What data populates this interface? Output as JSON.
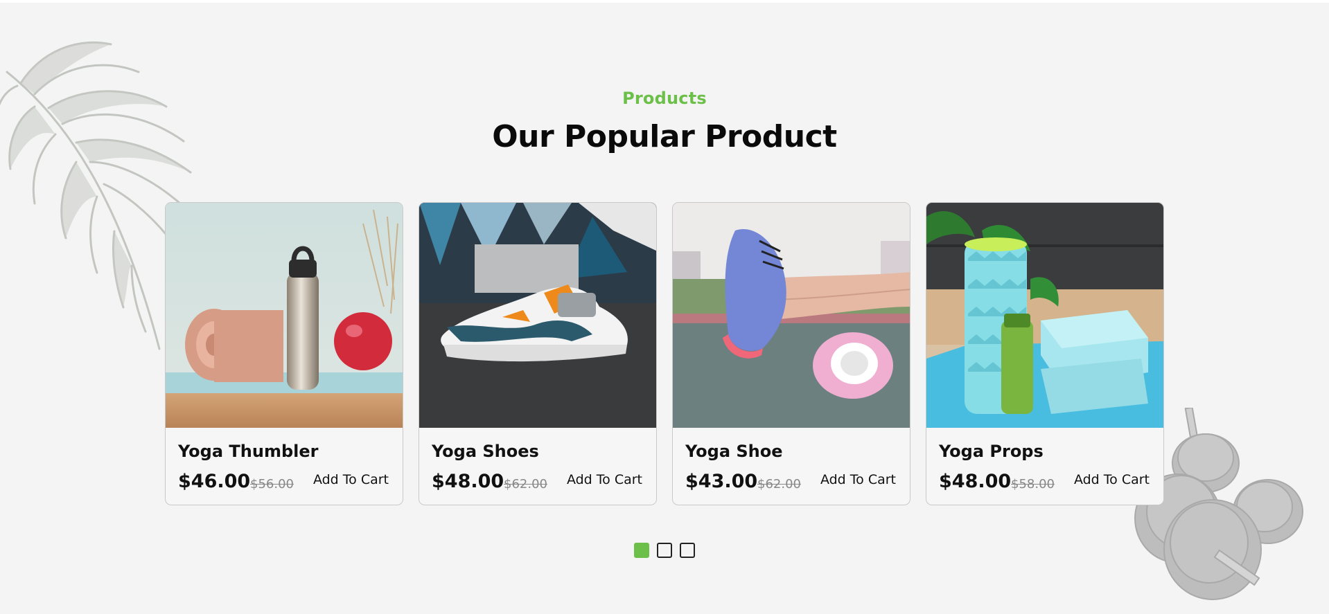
{
  "section": {
    "eyebrow": "Products",
    "title": "Our Popular Product"
  },
  "products": [
    {
      "name": "Yoga Thumbler",
      "price": "$46.00",
      "old_price": "$56.00",
      "cta": "Add To Cart",
      "image": "water-bottle-yoga-mat-ball"
    },
    {
      "name": "Yoga Shoes",
      "price": "$48.00",
      "old_price": "$62.00",
      "cta": "Add To Cart",
      "image": "sneaker-on-asphalt"
    },
    {
      "name": "Yoga Shoe",
      "price": "$43.00",
      "old_price": "$62.00",
      "cta": "Add To Cart",
      "image": "legs-on-foam-roller"
    },
    {
      "name": "Yoga Props",
      "price": "$48.00",
      "old_price": "$58.00",
      "cta": "Add To Cart",
      "image": "foam-roller-blocks-bottle"
    }
  ],
  "pagination": {
    "pages": 3,
    "active": 1
  },
  "colors": {
    "accent": "#6cc04a",
    "background": "#f4f4f4",
    "text": "#0a0a0a",
    "muted": "#888888"
  }
}
